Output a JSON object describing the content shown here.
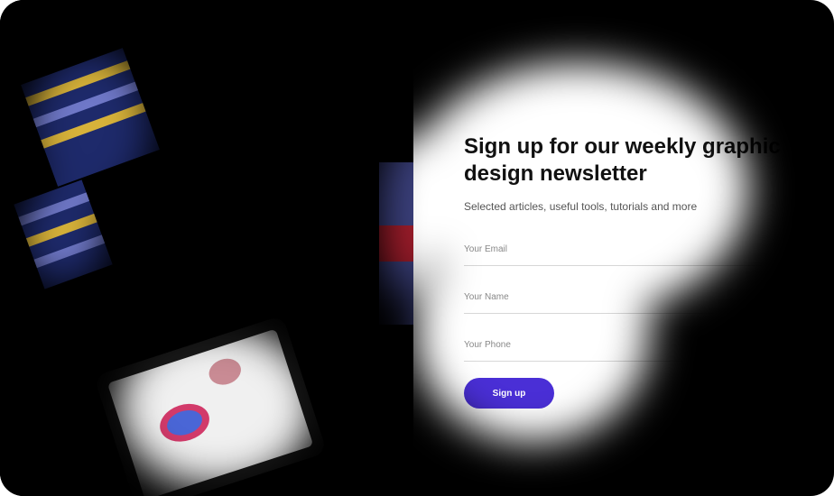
{
  "newsletter": {
    "heading": "Sign up for our weekly graphic design newsletter",
    "subtitle": "Selected articles, useful tools, tutorials and more",
    "fields": {
      "email_placeholder": "Your Email",
      "name_placeholder": "Your Name",
      "phone_placeholder": "Your Phone"
    },
    "submit_label": "Sign up"
  },
  "colors": {
    "accent": "#4a2fd6",
    "background": "#000000",
    "panel": "#ffffff"
  },
  "icons": [
    "tablet-illustration",
    "stripes-illustration"
  ]
}
